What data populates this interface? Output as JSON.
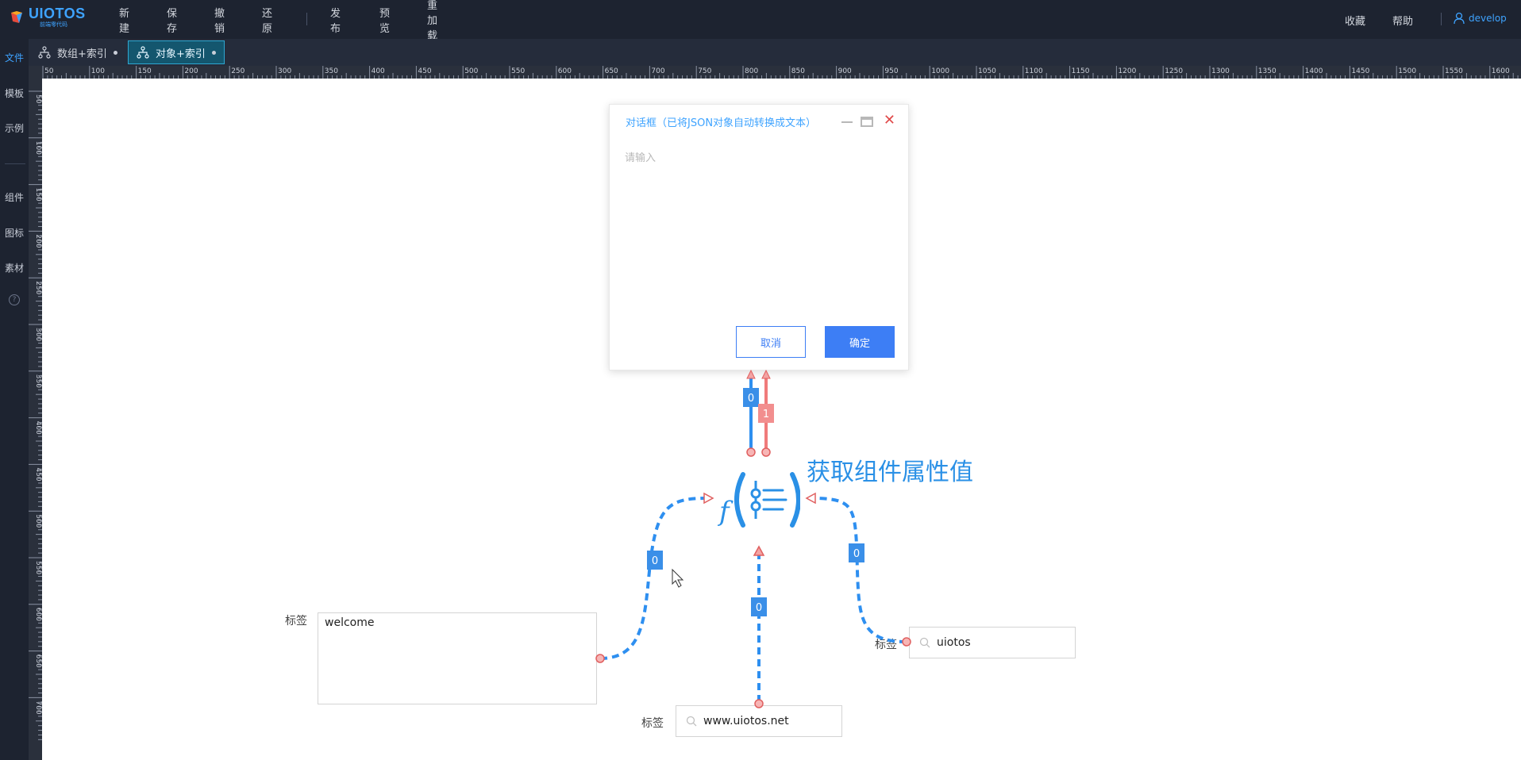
{
  "app": {
    "logo_text": "UIOTOS",
    "logo_subtitle": "前端零代码"
  },
  "toolbar": {
    "new": "新建",
    "save": "保存",
    "undo": "撤销",
    "redo": "还原",
    "publish": "发布",
    "preview": "预览",
    "reload": "重加载",
    "favorites": "收藏",
    "help": "帮助",
    "user": "develop"
  },
  "tabs": [
    {
      "label": "数组+索引",
      "active": false
    },
    {
      "label": "对象+索引",
      "active": true
    }
  ],
  "sidebar": {
    "items": [
      "文件",
      "模板",
      "示例",
      "组件",
      "图标",
      "素材"
    ],
    "help_icon": "?"
  },
  "ruler": {
    "top": [
      "50",
      "100",
      "150",
      "200",
      "250",
      "300",
      "350",
      "400",
      "450",
      "500",
      "550",
      "600",
      "650",
      "700",
      "750",
      "800",
      "850",
      "900",
      "950",
      "1000",
      "1050",
      "1100",
      "1150",
      "1200",
      "1250",
      "1300",
      "1350",
      "1400",
      "1450",
      "1500",
      "1550",
      "1600"
    ],
    "left": [
      "50",
      "100",
      "150",
      "200",
      "250",
      "300",
      "350",
      "400",
      "450",
      "500",
      "550",
      "600",
      "650",
      "700"
    ]
  },
  "dialog": {
    "title": "对话框（已将JSON对象自动转换成文本）",
    "placeholder": "请输入",
    "cancel": "取消",
    "ok": "确定"
  },
  "function_node": {
    "title": "获取组件属性值"
  },
  "links": {
    "dialog_in_0": "0",
    "dialog_in_1": "1",
    "left_in": "0",
    "right_in": "0",
    "bottom_in": "0"
  },
  "fields": {
    "textarea_label": "标签",
    "textarea_value": "welcome",
    "right_label": "标签",
    "right_value": "uiotos",
    "bottom_label": "标签",
    "bottom_value": "www.uiotos.net"
  },
  "colors": {
    "accent": "#3ea3ff",
    "primary_button": "#3d7ef5",
    "link_blue": "#2e8ff0",
    "link_red": "#f07b7b",
    "topbar": "#1d2330"
  }
}
